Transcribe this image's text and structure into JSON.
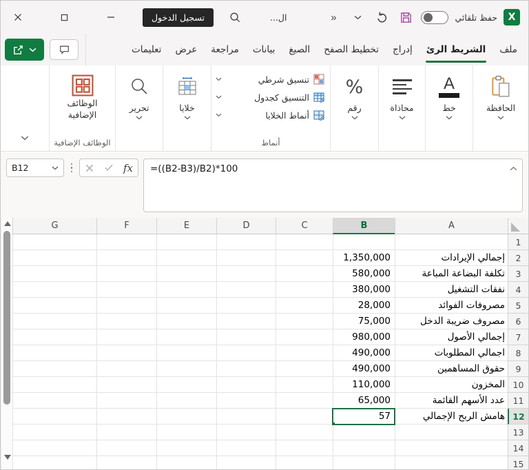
{
  "titlebar": {
    "autosave_label": "حفظ تلقائي",
    "doc_title": "ال...",
    "more_commands": "«",
    "sign_in": "تسجيل الدخول"
  },
  "tabs": {
    "file": "ملف",
    "home": "الشريط الرئ",
    "insert": "إدراج",
    "page_layout": "تخطيط الصفح",
    "formulas": "الصيغ",
    "data": "بيانات",
    "review": "مراجعة",
    "view": "عرض",
    "help": "تعليمات"
  },
  "ribbon": {
    "clipboard": "الحافظة",
    "font": "خط",
    "alignment": "محاذاة",
    "number": "رقم",
    "styles": {
      "conditional": "تنسيق شرطي",
      "format_table": "التنسيق كجدول",
      "cell_styles": "أنماط الخلايا",
      "group_label": "أنماط"
    },
    "cells": "خلايا",
    "editing": "تحرير",
    "addins": {
      "line1": "الوظائف",
      "line2": "الإضافية",
      "group_label": "الوظائف الإضافية"
    }
  },
  "formula_bar": {
    "name_box": "B12",
    "fx_label": "fx",
    "formula": "=((B2-B3)/B2)*100"
  },
  "sheet": {
    "columns": [
      "A",
      "B",
      "C",
      "D",
      "E",
      "F",
      "G"
    ],
    "selected_cell": "B12",
    "rows": [
      {
        "n": "1",
        "label": "",
        "value": ""
      },
      {
        "n": "2",
        "label": "إجمالي الإيرادات",
        "value": "1,350,000"
      },
      {
        "n": "3",
        "label": "تكلفة البضاعة المباعة",
        "value": "580,000"
      },
      {
        "n": "4",
        "label": "نفقات التشغيل",
        "value": "380,000"
      },
      {
        "n": "5",
        "label": "مصروفات الفوائد",
        "value": "28,000"
      },
      {
        "n": "6",
        "label": "مصروف ضريبة الدخل",
        "value": "75,000"
      },
      {
        "n": "7",
        "label": "إجمالي الأصول",
        "value": "980,000"
      },
      {
        "n": "8",
        "label": "اجمالي المطلوبات",
        "value": "490,000"
      },
      {
        "n": "9",
        "label": "حقوق المساهمين",
        "value": "490,000"
      },
      {
        "n": "10",
        "label": "المخزون",
        "value": "110,000"
      },
      {
        "n": "11",
        "label": "عدد الأسهم القائمة",
        "value": "65,000"
      },
      {
        "n": "12",
        "label": "هامش الربح الإجمالي",
        "value": "57"
      },
      {
        "n": "13",
        "label": "",
        "value": ""
      },
      {
        "n": "14",
        "label": "",
        "value": ""
      },
      {
        "n": "15",
        "label": "",
        "value": ""
      }
    ]
  },
  "colors": {
    "excel_green": "#107C41",
    "selection_green": "#1E7145",
    "save_icon_purple": "#A64CA6",
    "addins_icon_red": "#C4553A",
    "clipboard_icon_amber": "#DE9D43",
    "sign_in_black": "#262626"
  }
}
